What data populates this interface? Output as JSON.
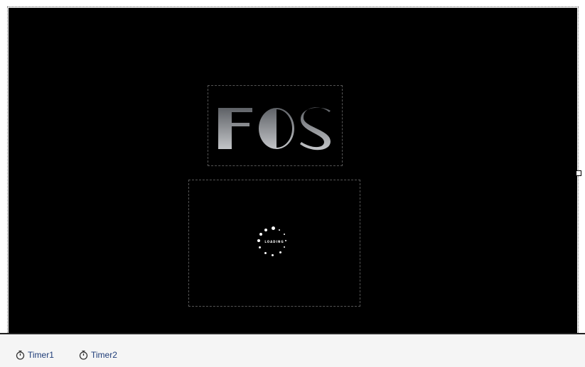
{
  "designer": {
    "logo_text": "FOS",
    "loading_text": "LOADING",
    "form_background": "#000000"
  },
  "component_tray": {
    "items": [
      {
        "label": "Timer1",
        "icon": "stopwatch-icon"
      },
      {
        "label": "Timer2",
        "icon": "stopwatch-icon"
      }
    ]
  }
}
